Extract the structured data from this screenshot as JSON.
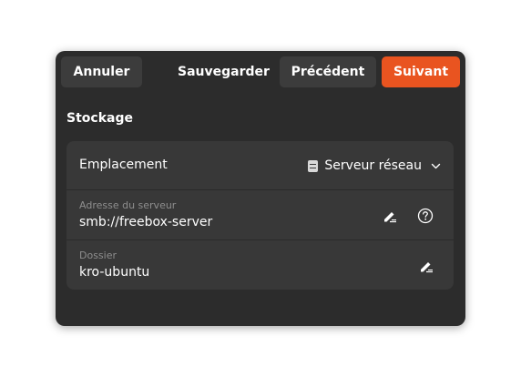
{
  "headerbar": {
    "cancel_label": "Annuler",
    "save_label": "Sauvegarder",
    "previous_label": "Précédent",
    "next_label": "Suivant"
  },
  "section": {
    "title": "Stockage"
  },
  "location_row": {
    "label": "Emplacement",
    "selected_value": "Serveur réseau",
    "icon": "server-icon"
  },
  "server_row": {
    "label": "Adresse du serveur",
    "value": "smb://freebox-server",
    "icons": [
      "edit-icon",
      "help-icon"
    ]
  },
  "folder_row": {
    "label": "Dossier",
    "value": "kro-ubuntu",
    "icons": [
      "edit-icon"
    ]
  },
  "colors": {
    "accent": "#e95420",
    "window_bg": "#2c2c2c",
    "card_bg": "#383838",
    "button_bg": "#3c3c3c"
  }
}
